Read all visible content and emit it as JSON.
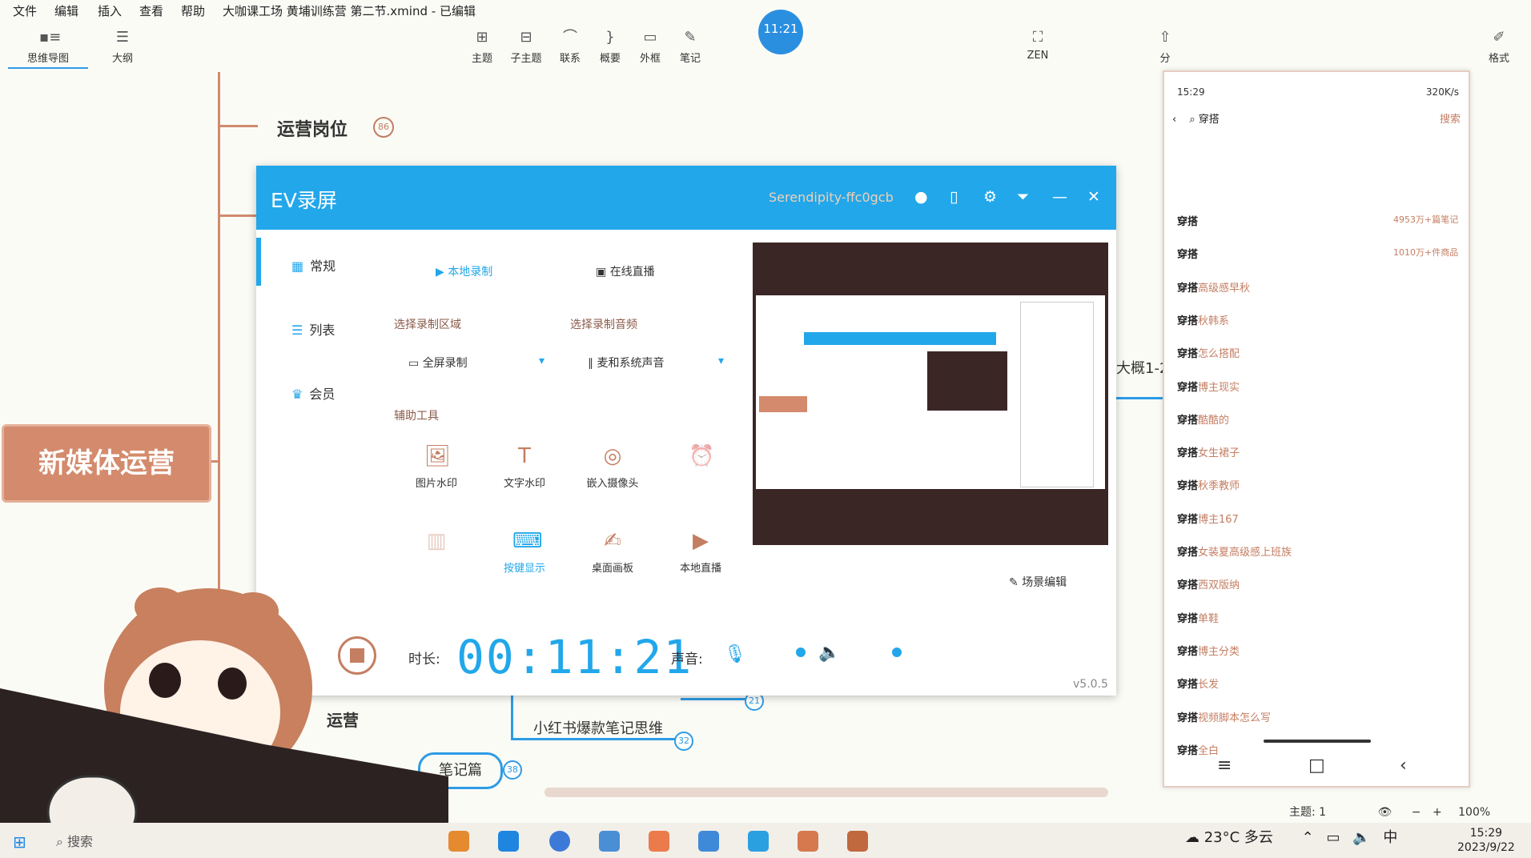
{
  "menu": [
    "文件",
    "编辑",
    "插入",
    "查看",
    "帮助"
  ],
  "window_title": "大咖课工场 黄埔训练营 第二节.xmind - 已编辑",
  "toolbar_left": [
    {
      "label": "思维导图",
      "icon": "mindmap-icon"
    },
    {
      "label": "大纲",
      "icon": "outline-icon"
    }
  ],
  "toolbar_center": [
    {
      "label": "主题",
      "icon": "topic-icon"
    },
    {
      "label": "子主题",
      "icon": "subtopic-icon"
    },
    {
      "label": "联系",
      "icon": "relationship-icon"
    },
    {
      "label": "概要",
      "icon": "summary-icon"
    },
    {
      "label": "外框",
      "icon": "boundary-icon"
    },
    {
      "label": "笔记",
      "icon": "note-icon"
    }
  ],
  "toolbar_right": [
    {
      "label": "ZEN",
      "icon": "zen-icon"
    },
    {
      "label": "分",
      "icon": "share-icon"
    },
    {
      "label": "格式",
      "icon": "format-icon"
    }
  ],
  "recording_time_bubble": "11:21",
  "mindmap": {
    "topic_1": "运营岗位",
    "topic_1_badge": "86",
    "central": "新媒体运营",
    "node_right": "大概1-2",
    "node_bottom_1": "运营",
    "node_bottom_2": "小红书爆款笔记思维",
    "node_bottom_2_badge": "32",
    "node_bottom_3": "笔记篇",
    "node_bottom_3_badge": "38",
    "node_badge_21": "21"
  },
  "ev": {
    "title": "EV录屏",
    "user": "Serendipity-ffc0gcb",
    "sidebar": [
      "常规",
      "列表",
      "会员"
    ],
    "tabs": [
      "本地录制",
      "在线直播"
    ],
    "label_area": "选择录制区域",
    "label_audio": "选择录制音频",
    "area_value": "全屏录制",
    "audio_value": "麦和系统声音",
    "label_tools": "辅助工具",
    "tools_row1": [
      "图片水印",
      "文字水印",
      "嵌入摄像头",
      ""
    ],
    "tools_row2": [
      "",
      "按键显示",
      "桌面画板",
      "本地直播"
    ],
    "scene_edit": "场景编辑",
    "duration_label": "时长:",
    "timer": "00:11:21",
    "volume_label": "声音:",
    "version": "v5.0.5"
  },
  "phone": {
    "time": "15:29",
    "net": "320K/s",
    "search_text": "穿搭",
    "search_btn": "搜索",
    "results": [
      {
        "bold": "穿搭",
        "rest": "",
        "meta": "4953万+篇笔记"
      },
      {
        "bold": "穿搭",
        "rest": "",
        "meta": "1010万+件商品"
      },
      {
        "bold": "穿搭",
        "rest": "高级感早秋",
        "meta": ""
      },
      {
        "bold": "穿搭",
        "rest": "秋韩系",
        "meta": ""
      },
      {
        "bold": "穿搭",
        "rest": "怎么搭配",
        "meta": ""
      },
      {
        "bold": "穿搭",
        "rest": "博主现实",
        "meta": ""
      },
      {
        "bold": "穿搭",
        "rest": "酷酷的",
        "meta": ""
      },
      {
        "bold": "穿搭",
        "rest": "女生裙子",
        "meta": ""
      },
      {
        "bold": "穿搭",
        "rest": "秋季教师",
        "meta": ""
      },
      {
        "bold": "穿搭",
        "rest": "博主167",
        "meta": ""
      },
      {
        "bold": "穿搭",
        "rest": "女装夏高级感上班族",
        "meta": ""
      },
      {
        "bold": "穿搭",
        "rest": "西双版纳",
        "meta": ""
      },
      {
        "bold": "穿搭",
        "rest": "单鞋",
        "meta": ""
      },
      {
        "bold": "穿搭",
        "rest": "博主分类",
        "meta": ""
      },
      {
        "bold": "穿搭",
        "rest": "长发",
        "meta": ""
      },
      {
        "bold": "穿搭",
        "rest": "视频脚本怎么写",
        "meta": ""
      },
      {
        "bold": "穿搭",
        "rest": "全白",
        "meta": ""
      }
    ]
  },
  "status": {
    "topic_label": "主题: 1",
    "zoom": "100%"
  },
  "taskbar": {
    "search": "搜索",
    "weather": "23°C 多云",
    "ime": "中",
    "time": "15:29",
    "date": "2023/9/22"
  },
  "colors": {
    "ev_blue": "#22a7ea",
    "map_brown": "#d48a6c",
    "accent_blue": "#2d9be6"
  }
}
